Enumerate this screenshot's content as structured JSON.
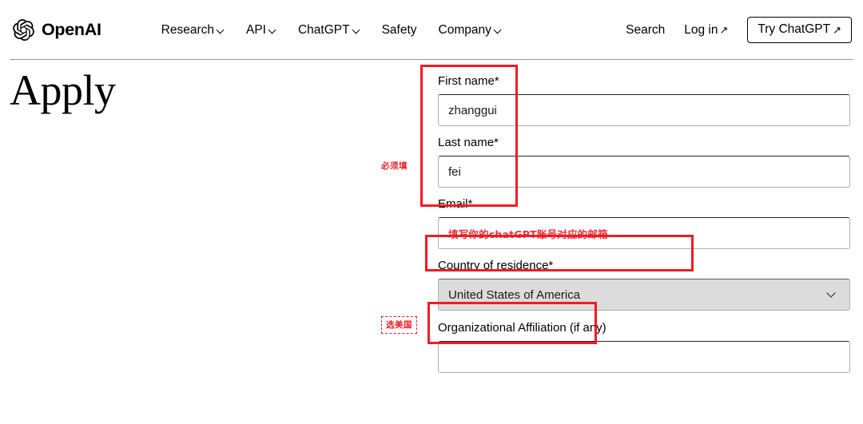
{
  "header": {
    "brand": {
      "name": "OpenAI",
      "logo_icon": "openai-logo-icon"
    },
    "nav_main": [
      {
        "label": "Research",
        "has_chevron": true
      },
      {
        "label": "API",
        "has_chevron": true
      },
      {
        "label": "ChatGPT",
        "has_chevron": true
      },
      {
        "label": "Safety",
        "has_chevron": false
      },
      {
        "label": "Company",
        "has_chevron": true
      }
    ],
    "nav_right": {
      "search_label": "Search",
      "login_label": "Log in",
      "login_arrow": "↗",
      "try_label": "Try ChatGPT",
      "try_arrow": "↗"
    }
  },
  "page": {
    "title": "Apply"
  },
  "form": {
    "fields": [
      {
        "label": "First name*",
        "value": "zhanggui",
        "placeholder": "",
        "type": "text"
      },
      {
        "label": "Last name*",
        "value": "fei",
        "placeholder": "",
        "type": "text"
      },
      {
        "label": "Email*",
        "value": "填写你的chatGPT账号对应的邮箱",
        "placeholder": "",
        "type": "text"
      },
      {
        "label": "Country of residence*",
        "value": "United States of America",
        "type": "select"
      },
      {
        "label": "Organizational Affiliation (if any)",
        "value": "",
        "placeholder": "",
        "type": "text"
      }
    ]
  },
  "annotations": {
    "color": "#ee1c25",
    "names_note": "必须填",
    "country_note": "选美国"
  }
}
